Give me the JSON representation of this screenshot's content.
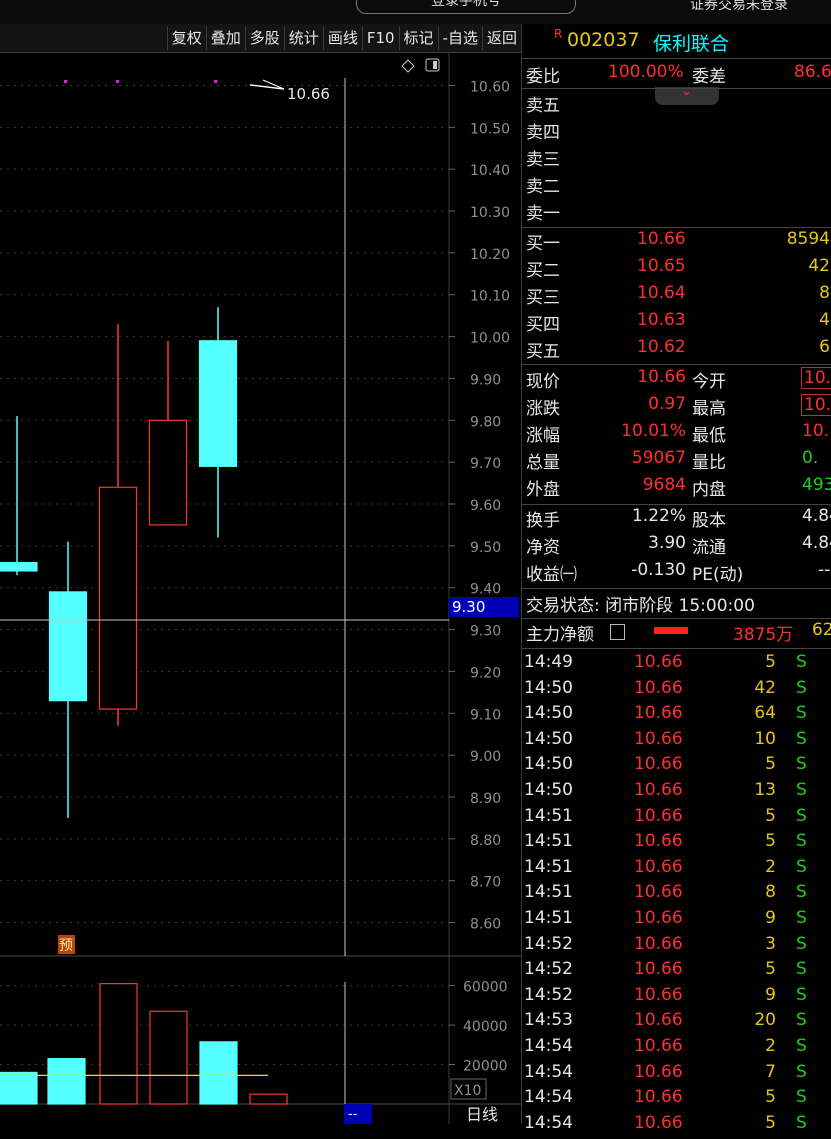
{
  "topbar": {
    "login_label": "登录手机号",
    "trade_status": "证券交易未登录"
  },
  "toolbar": {
    "buttons": [
      "复权",
      "叠加",
      "多股",
      "统计",
      "画线",
      "F10",
      "标记",
      "-自选",
      "返回"
    ]
  },
  "chart": {
    "period_label": "日线",
    "high_marker": "10.66",
    "cursor_price": "9.30",
    "cursor_x_label": "--",
    "forecast_badge": "预",
    "volume_unit": "X10",
    "price_ticks": [
      "10.60",
      "10.50",
      "10.40",
      "10.30",
      "10.20",
      "10.10",
      "10.00",
      "9.90",
      "9.80",
      "9.70",
      "9.60",
      "9.50",
      "9.40",
      "9.30",
      "9.20",
      "9.10",
      "9.00",
      "8.90",
      "8.80",
      "8.70",
      "8.60"
    ],
    "volume_ticks": [
      "60000",
      "40000",
      "20000"
    ],
    "colors": {
      "up": "#ff3232",
      "down": "#54ffff",
      "ma": "#e6e600",
      "cursor": "#c8c8c8",
      "cursor_tag_bg": "#0000b4"
    }
  },
  "chart_data": {
    "type": "candlestick",
    "ylim": [
      8.52,
      10.68
    ],
    "candles": [
      {
        "open": 9.46,
        "close": 9.44,
        "high": 9.81,
        "low": 9.43,
        "direction": "down"
      },
      {
        "open": 9.39,
        "close": 9.13,
        "high": 9.51,
        "low": 8.85,
        "direction": "down"
      },
      {
        "open": 9.11,
        "close": 9.64,
        "high": 10.03,
        "low": 9.07,
        "direction": "up"
      },
      {
        "open": 9.55,
        "close": 9.8,
        "high": 9.99,
        "low": 9.55,
        "direction": "up"
      },
      {
        "open": 9.99,
        "close": 9.69,
        "high": 10.07,
        "low": 9.52,
        "direction": "down"
      }
    ],
    "volume": {
      "ylim": [
        0,
        75000
      ],
      "bars": [
        {
          "value": 16000,
          "direction": "down"
        },
        {
          "value": 23000,
          "direction": "down"
        },
        {
          "value": 61000,
          "direction": "up"
        },
        {
          "value": 47000,
          "direction": "up"
        },
        {
          "value": 31500,
          "direction": "down"
        },
        {
          "value": 5000,
          "direction": "up"
        }
      ],
      "ma_value": 14500
    }
  },
  "quote": {
    "r_badge": "R",
    "code": "002037",
    "name": "保利联合",
    "weibi_label": "委比",
    "weibi_value": "100.00%",
    "weicha_label": "委差",
    "weicha_value": "86.6",
    "asks": [
      "卖五",
      "卖四",
      "卖三",
      "卖二",
      "卖一"
    ],
    "bids": [
      {
        "label": "买一",
        "price": "10.66",
        "vol": "8594"
      },
      {
        "label": "买二",
        "price": "10.65",
        "vol": "42"
      },
      {
        "label": "买三",
        "price": "10.64",
        "vol": "8"
      },
      {
        "label": "买四",
        "price": "10.63",
        "vol": "4"
      },
      {
        "label": "买五",
        "price": "10.62",
        "vol": "6"
      }
    ],
    "stats1": [
      {
        "l1": "现价",
        "v1": "10.66",
        "l2": "今开",
        "v2": "10."
      },
      {
        "l1": "涨跌",
        "v1": "0.97",
        "l2": "最高",
        "v2": "10."
      },
      {
        "l1": "涨幅",
        "v1": "10.01%",
        "l2": "最低",
        "v2": "10."
      },
      {
        "l1": "总量",
        "v1": "59067",
        "l2": "量比",
        "v2": "0."
      },
      {
        "l1": "外盘",
        "v1": "9684",
        "l2": "内盘",
        "v2": "493"
      }
    ],
    "stats2": [
      {
        "l1": "换手",
        "v1": "1.22%",
        "l2": "股本",
        "v2": "4.84"
      },
      {
        "l1": "净资",
        "v1": "3.90",
        "l2": "流通",
        "v2": "4.84"
      },
      {
        "l1": "收益㈠",
        "v1": "-0.130",
        "l2": "PE(动)",
        "v2": "--"
      }
    ],
    "status_text": "交易状态: 闭市阶段 15:00:00",
    "mainforce_label": "主力净额",
    "mainforce_value": "3875万",
    "mainforce_extra": "62"
  },
  "ticks": [
    {
      "t": "14:49",
      "p": "10.66",
      "v": "5",
      "s": "S"
    },
    {
      "t": "14:50",
      "p": "10.66",
      "v": "42",
      "s": "S"
    },
    {
      "t": "14:50",
      "p": "10.66",
      "v": "64",
      "s": "S"
    },
    {
      "t": "14:50",
      "p": "10.66",
      "v": "10",
      "s": "S"
    },
    {
      "t": "14:50",
      "p": "10.66",
      "v": "5",
      "s": "S"
    },
    {
      "t": "14:50",
      "p": "10.66",
      "v": "13",
      "s": "S"
    },
    {
      "t": "14:51",
      "p": "10.66",
      "v": "5",
      "s": "S"
    },
    {
      "t": "14:51",
      "p": "10.66",
      "v": "5",
      "s": "S"
    },
    {
      "t": "14:51",
      "p": "10.66",
      "v": "2",
      "s": "S"
    },
    {
      "t": "14:51",
      "p": "10.66",
      "v": "8",
      "s": "S"
    },
    {
      "t": "14:51",
      "p": "10.66",
      "v": "9",
      "s": "S"
    },
    {
      "t": "14:52",
      "p": "10.66",
      "v": "3",
      "s": "S"
    },
    {
      "t": "14:52",
      "p": "10.66",
      "v": "5",
      "s": "S"
    },
    {
      "t": "14:52",
      "p": "10.66",
      "v": "9",
      "s": "S"
    },
    {
      "t": "14:53",
      "p": "10.66",
      "v": "20",
      "s": "S"
    },
    {
      "t": "14:54",
      "p": "10.66",
      "v": "2",
      "s": "S"
    },
    {
      "t": "14:54",
      "p": "10.66",
      "v": "7",
      "s": "S"
    },
    {
      "t": "14:54",
      "p": "10.66",
      "v": "5",
      "s": "S"
    },
    {
      "t": "14:54",
      "p": "10.66",
      "v": "5",
      "s": "S"
    }
  ]
}
